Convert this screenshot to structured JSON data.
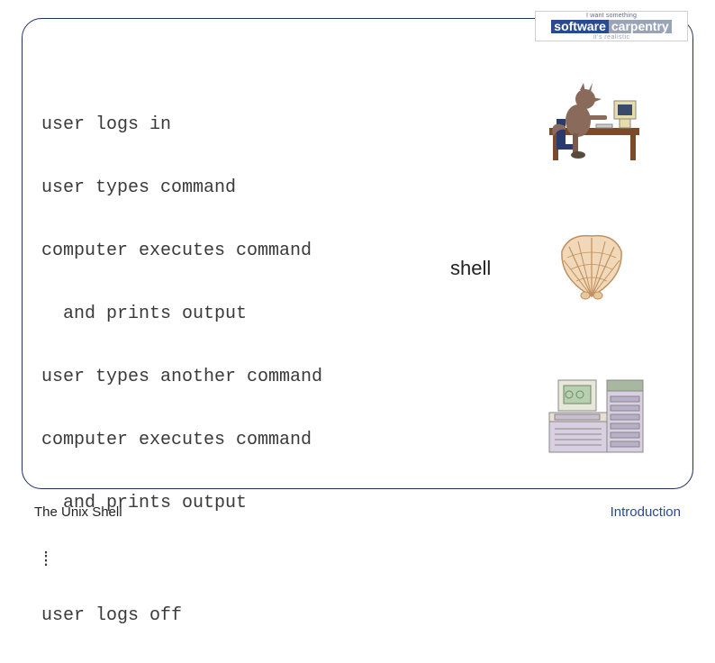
{
  "logo": {
    "top": "I want something",
    "software": "software",
    "carpentry": "carpentry",
    "bottom": "it's realistic"
  },
  "lines": {
    "l0": "user logs in",
    "l1": "user types command",
    "l2": "computer executes command",
    "l3": "  and prints output",
    "l4": "user types another command",
    "l5": "computer executes command",
    "l6": "  and prints output",
    "l7": "user logs off"
  },
  "vdots": "⁞",
  "shell_label": "shell",
  "icons": {
    "user": "wolf-at-computer",
    "shell": "seashell",
    "computer": "mainframe-computer"
  },
  "footer": {
    "left": "The Unix Shell",
    "right": "Introduction"
  }
}
